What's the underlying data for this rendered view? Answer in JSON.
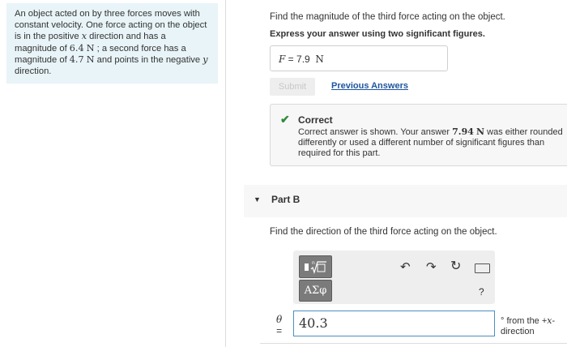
{
  "problem": {
    "text_1": "An object acted on by three forces moves with constant velocity. One force acting on the object is in the positive ",
    "x_var": "x",
    "text_2": " direction and has a magnitude of ",
    "f1_value": "6.4",
    "unit_N": "N",
    "text_3": " ; a second force has a magnitude of ",
    "f2_value": "4.7",
    "text_4": " and points in the negative ",
    "y_var": "y",
    "text_5": " direction."
  },
  "part_a": {
    "question": "Find the magnitude of the third force acting on the object.",
    "instruction": "Express your answer using two significant figures.",
    "answer_var": "F",
    "answer_eq": " = ",
    "answer_value": "7.9",
    "answer_unit": "N",
    "submit_label": "Submit",
    "previous_answers_label": "Previous Answers",
    "feedback": {
      "title": "Correct",
      "msg_1": "Correct answer is shown. Your answer ",
      "your_value": "7.94",
      "msg_unit": "N",
      "msg_2": " was either rounded differently or used a different number of significant figures than required for this part."
    }
  },
  "part_b": {
    "title": "Part B",
    "question": "Find the direction of the third force acting on the object.",
    "toolbar": {
      "sqrt_symbol": "√",
      "greek_label": "ΑΣφ",
      "undo_icon": "undo-icon",
      "redo_icon": "redo-icon",
      "reset_icon": "reset-icon",
      "keyboard_icon": "keyboard-icon",
      "help_label": "?"
    },
    "theta_label": "θ",
    "theta_eq": "=",
    "answer_value": "40.3",
    "unit_1": "° from the +",
    "unit_var": "x",
    "unit_2": "-",
    "unit_3": "direction"
  },
  "colors": {
    "problem_bg": "#e8f4f8",
    "correct_green": "#2e8a3e",
    "link_blue": "#1f56a0",
    "input_border": "#4a90c2"
  }
}
